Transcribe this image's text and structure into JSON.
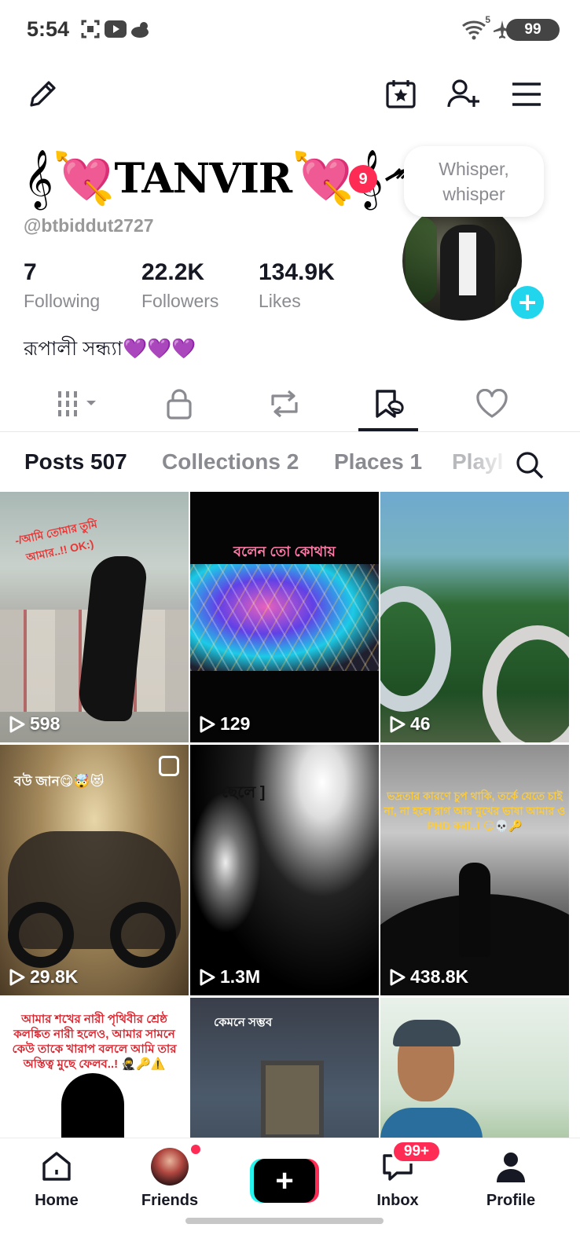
{
  "status_bar": {
    "time": "5:54",
    "battery": "99",
    "signal_label": "5",
    "icons": [
      "screenshot-icon",
      "youtube-icon",
      "weather-icon",
      "wifi-icon",
      "airplane-icon"
    ]
  },
  "top_bar": {
    "icons": [
      "edit-pencil-icon",
      "calendar-star-icon",
      "add-friend-icon",
      "menu-icon"
    ]
  },
  "profile": {
    "display_name_text": "TANVIR",
    "display_name_left": "𝄞💘",
    "display_name_right": "💘𝄞",
    "notification_count": "9",
    "username": "@btbiddut2727",
    "whisper_bubble": "Whisper, whisper",
    "stats": [
      {
        "value": "7",
        "label": "Following"
      },
      {
        "value": "22.2K",
        "label": "Followers"
      },
      {
        "value": "134.9K",
        "label": "Likes"
      }
    ],
    "bio": "রূপালী সন্ধ্যা💜💜💜"
  },
  "content_tabs": {
    "icons": [
      "videos-grid-icon",
      "private-lock-icon",
      "repost-icon",
      "favorites-icon",
      "liked-heart-icon"
    ],
    "active_index": 3
  },
  "sub_tabs": [
    {
      "label": "Posts 507",
      "state": "active"
    },
    {
      "label": "Collections 2",
      "state": "normal"
    },
    {
      "label": "Places 1",
      "state": "normal"
    },
    {
      "label": "Playl",
      "state": "fade"
    }
  ],
  "grid": [
    {
      "views": "598",
      "caption": "-/আমি তোমার তুমি আমার..!! OK:)"
    },
    {
      "views": "129",
      "caption": "বলেন তো কোথায়"
    },
    {
      "views": "46",
      "caption": ""
    },
    {
      "views": "29.8K",
      "caption": "বউ জান😋🤯😻"
    },
    {
      "views": "1.3M",
      "caption": "ছেলে ]"
    },
    {
      "views": "438.8K",
      "caption": "ভদ্রতার কারণে চুপ থাকি, তর্কে যেতে চাই না, না হলে রাগ আর মুখের ভাষা আমার ও PHD করা..! 😏💀🔑"
    },
    {
      "views": "",
      "caption": "আমার শখের নারী পৃথিবীর শ্রেষ্ঠ কলঙ্কিত নারী হলেও, আমার সামনে কেউ তাকে খারাপ বললে আমি তার অস্তিত্ব মুছে ফেলব..! 🥷🔑⚠️"
    },
    {
      "views": "",
      "caption": "কেমনে সম্ভব"
    },
    {
      "views": "",
      "caption": ""
    }
  ],
  "bottom_nav": {
    "items": [
      {
        "label": "Home",
        "icon": "home-icon"
      },
      {
        "label": "Friends",
        "icon": "friends-avatar"
      },
      {
        "label": "",
        "icon": "create-plus-icon"
      },
      {
        "label": "Inbox",
        "icon": "inbox-icon"
      },
      {
        "label": "Profile",
        "icon": "profile-icon"
      }
    ],
    "create_symbol": "+",
    "inbox_badge": "99+"
  },
  "colors": {
    "accent_pink": "#fe2c55",
    "accent_cyan": "#20d5ec",
    "text_primary": "#161823",
    "text_secondary": "#8a8b91"
  }
}
